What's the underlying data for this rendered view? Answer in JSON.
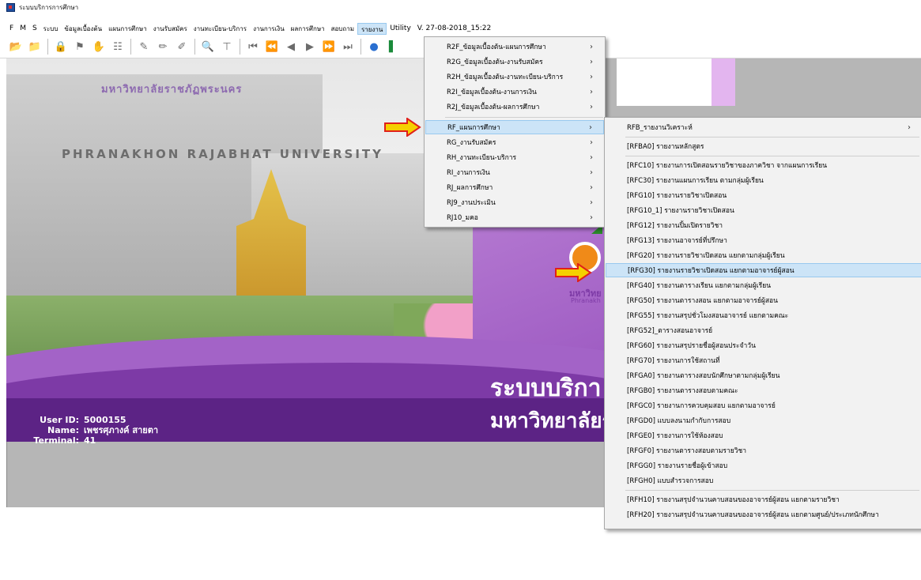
{
  "window": {
    "title": "ระบบบริการการศึกษา"
  },
  "menubar": {
    "items": [
      {
        "label": "F",
        "big": true
      },
      {
        "label": "M",
        "big": true
      },
      {
        "label": "S",
        "big": true
      },
      {
        "label": "ระบบ"
      },
      {
        "label": "ข้อมูลเบื้องต้น"
      },
      {
        "label": "แผนการศึกษา"
      },
      {
        "label": "งานรับสมัคร"
      },
      {
        "label": "งานทะเบียน-บริการ"
      },
      {
        "label": "งานการเงิน"
      },
      {
        "label": "ผลการศึกษา"
      },
      {
        "label": "สอบถาม"
      },
      {
        "label": "รายงาน",
        "active": true
      },
      {
        "label": "Utility",
        "big": true
      },
      {
        "label": "V. 27-08-2018_15:22",
        "big": true
      }
    ]
  },
  "toolbar": {
    "icons": [
      "open-folder-icon",
      "save-folder-icon",
      "lock-icon",
      "find-file-icon",
      "hand-icon",
      "page-icon",
      "pencil-icon",
      "pencil-plus-icon",
      "pencil-edit-icon",
      "binoculars-icon",
      "filter-icon",
      "first-record-icon",
      "prev-page-icon",
      "prev-record-icon",
      "next-record-icon",
      "next-page-icon",
      "last-record-icon",
      "globe-icon",
      "exit-icon"
    ]
  },
  "banner": {
    "university_thai": "มหาวิทยาลัยราชภัฏพระนคร",
    "university_en": "PHRANAKHON RAJABHAT UNIVERSITY",
    "big_title_line1": "ระบบบริกา",
    "big_title_line2": "มหาวิทยาลัยรา",
    "logo_text_thai": "มหาวิทย",
    "logo_text_en": "Phranakh"
  },
  "user": {
    "id_label": "User ID:",
    "id_value": "5000155",
    "name_label": "Name:",
    "name_value": "เพชรศุภางค์ สายตา",
    "terminal_label": "Terminal:",
    "terminal_value": "41"
  },
  "report_menu": {
    "items": [
      {
        "label": "R2F_ข้อมูลเบื้องต้น-แผนการศึกษา",
        "has_sub": true
      },
      {
        "label": "R2G_ข้อมูลเบื้องต้น-งานรับสมัคร",
        "has_sub": true
      },
      {
        "label": "R2H_ข้อมูลเบื้องต้น-งานทะเบียน-บริการ",
        "has_sub": true
      },
      {
        "label": "R2I_ข้อมูลเบื้องต้น-งานการเงิน",
        "has_sub": true
      },
      {
        "label": "R2J_ข้อมูลเบื้องต้น-ผลการศึกษา",
        "has_sub": true
      },
      {
        "label": "RF_แผนการศึกษา",
        "has_sub": true,
        "highlight": true
      },
      {
        "label": "RG_งานรับสมัคร",
        "has_sub": true
      },
      {
        "label": "RH_งานทะเบียน-บริการ",
        "has_sub": true
      },
      {
        "label": "RI_งานการเงิน",
        "has_sub": true
      },
      {
        "label": "RJ_ผลการศึกษา",
        "has_sub": true
      },
      {
        "label": "RJ9_งานประเมิน",
        "has_sub": true
      },
      {
        "label": "RJ10_มคอ",
        "has_sub": true
      }
    ]
  },
  "rf_submenu": {
    "items": [
      {
        "label": "RFB_รายงานวิเคราะห์",
        "has_sub": true
      },
      {
        "label": "[RFBA0] รายงานหลักสูตร"
      },
      {
        "label": "[RFC10] รายงานการเปิดสอนรายวิชาของภาควิชา จากแผนการเรียน"
      },
      {
        "label": "[RFC30] รายงานแผนการเรียน ตามกลุ่มผู้เรียน"
      },
      {
        "label": "[RFG10] รายงานรายวิชาเปิดสอน"
      },
      {
        "label": "[RFG10_1] รายงานรายวิชาเปิดสอน"
      },
      {
        "label": "[RFG12] รายงานปิ้มเปิดรายวิชา"
      },
      {
        "label": "[RFG13] รายงานอาจารย์ที่ปรึกษา"
      },
      {
        "label": "[RFG20] รายงานรายวิชาเปิดสอน แยกตามกลุ่มผู้เรียน"
      },
      {
        "label": "[RFG30] รายงานรายวิชาเปิดสอน แยกตามอาจารย์ผู้สอน",
        "highlight": true
      },
      {
        "label": "[RFG40] รายงานตารางเรียน แยกตามกลุ่มผู้เรียน"
      },
      {
        "label": "[RFG50] รายงานตารางสอน แยกตามอาจารย์ผู้สอน"
      },
      {
        "label": "[RFG55] รายงานสรุปชั่วโมงสอนอาจารย์ แยกตามคณะ"
      },
      {
        "label": "[RFG52]_ตารางสอนอาจารย์"
      },
      {
        "label": "[RFG60] รายงานสรุปรายชื่อผู้สอนประจำวัน"
      },
      {
        "label": "[RFG70] รายงานการใช้สถานที่"
      },
      {
        "label": "[RFGA0] รายงานตารางสอบนักศึกษาตามกลุ่มผู้เรียน"
      },
      {
        "label": "[RFGB0] รายงานตารางสอบตามคณะ"
      },
      {
        "label": "[RFGC0] รายงานการควบคุมสอบ แยกตามอาจารย์"
      },
      {
        "label": "[RFGD0] แบบลงนามกำกับการสอบ"
      },
      {
        "label": "[RFGE0] รายงานการใช้ห้องสอบ"
      },
      {
        "label": "[RFGF0] รายงานตารางสอบตามรายวิชา"
      },
      {
        "label": "[RFGG0] รายงานรายชื่อผู้เข้าสอบ"
      },
      {
        "label": "[RFGH0] แบบสำรวจการสอบ"
      },
      {
        "label": "[RFH10] รายงานสรุปจำนวนคาบสอนของอาจารย์ผู้สอน แยกตามรายวิชา"
      },
      {
        "label": "[RFH20] รายงานสรุปจำนวนคาบสอนของอาจารย์ผู้สอน แยกตามศูนย์/ประเภทนักศึกษา"
      }
    ]
  },
  "colors": {
    "menu_highlight": "#cce4f7",
    "menu_highlight_border": "#99c9ef",
    "arrow_fill": "#f5d000",
    "arrow_stroke": "#e0201a",
    "banner_purple": "#7d3aa6"
  }
}
